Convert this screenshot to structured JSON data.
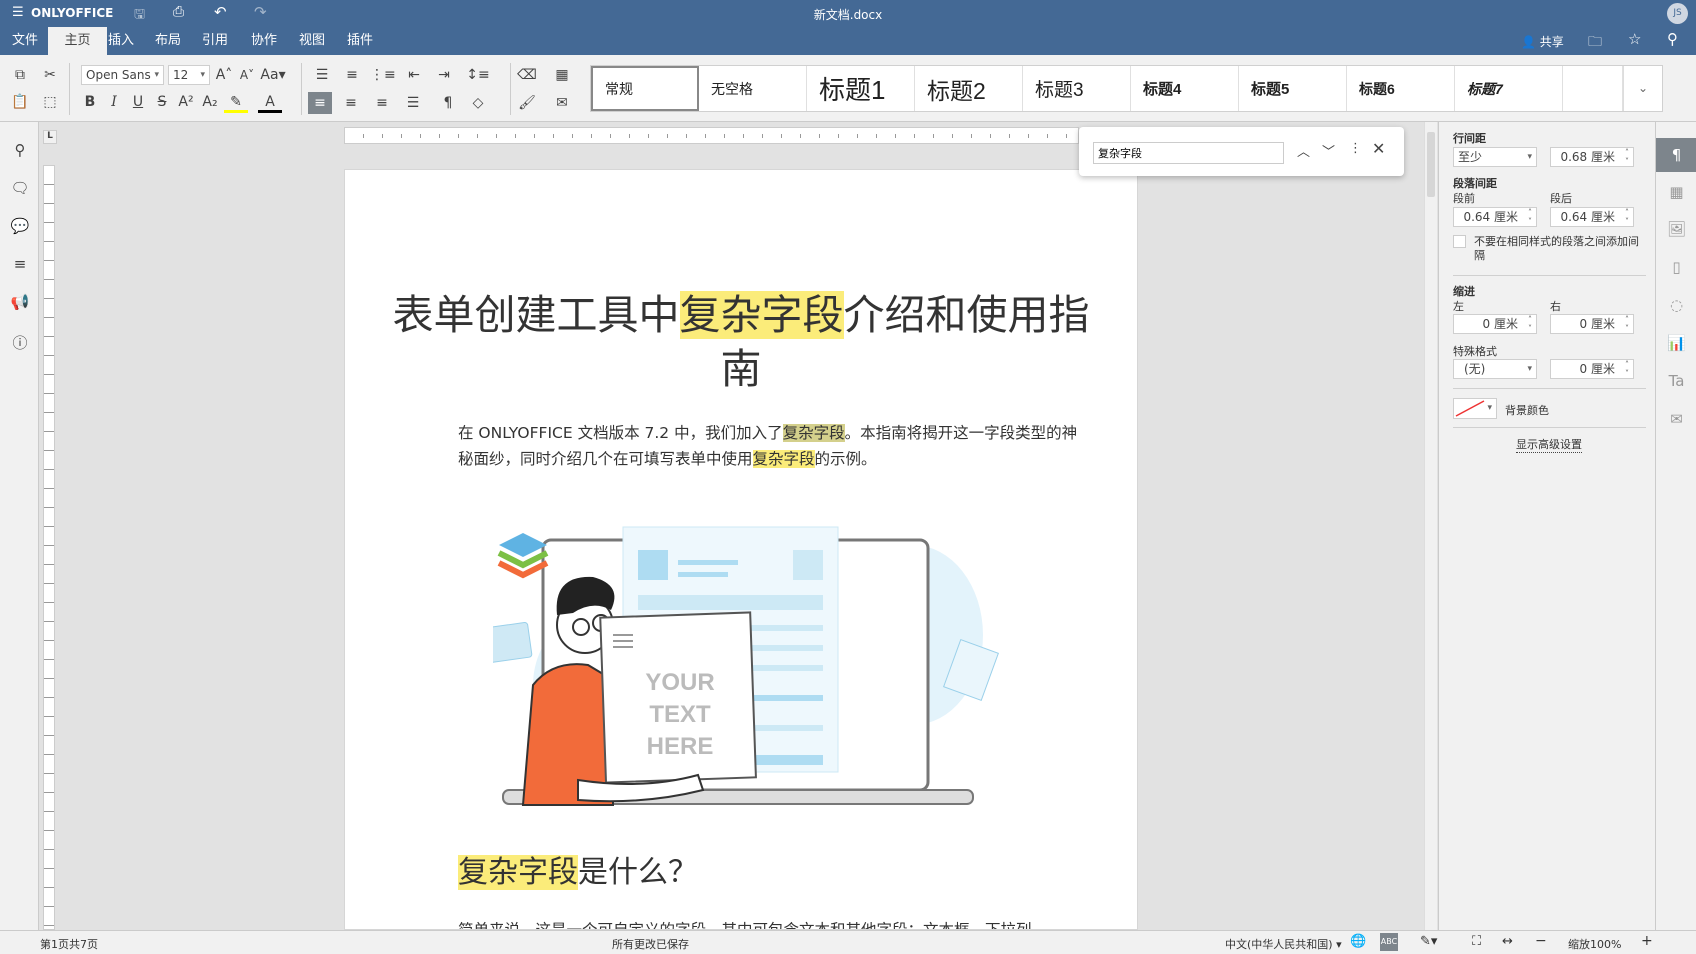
{
  "app": {
    "brand": "ONLYOFFICE",
    "doc_title": "新文档.docx",
    "avatar": "JS",
    "share_label": "共享"
  },
  "menu": {
    "tabs": [
      "文件",
      "主页",
      "插入",
      "布局",
      "引用",
      "协作",
      "视图",
      "插件"
    ],
    "active": "主页"
  },
  "toolbar": {
    "font_name": "Open Sans",
    "font_size": "12",
    "case_label": "Aa"
  },
  "styles": [
    "常规",
    "无空格",
    "标题1",
    "标题2",
    "标题3",
    "标题4",
    "标题5",
    "标题6",
    "标题7"
  ],
  "find": {
    "value": "复杂字段"
  },
  "document": {
    "title_pre": "表单创建工具中",
    "title_hl": "复杂字段",
    "title_post": "介绍和使用指南",
    "p1_a": "在 ONLYOFFICE 文档版本 7.2 中，我们加入了",
    "p1_hl1": "复杂字段",
    "p1_b": "。本指南将揭开这一字段类型的神秘面纱，同时介绍几个在可填写表单中使用",
    "p1_hl2": "复杂字段",
    "p1_c": "的示例。",
    "illus_text": [
      "YOUR",
      "TEXT",
      "HERE"
    ],
    "h2_hl": "复杂字段",
    "h2_post": "是什么？",
    "p2": "简单来说，这是一个可自定义的字段，其中可包含文本和其他字段：文本框、下拉列"
  },
  "panel": {
    "line_spacing": "行间距",
    "line_mode": "至少",
    "line_value": "0.68 厘米",
    "para_spacing": "段落间距",
    "before": "段前",
    "after": "段后",
    "before_value": "0.64 厘米",
    "after_value": "0.64 厘米",
    "no_space_label": "不要在相同样式的段落之间添加间隔",
    "indent": "缩进",
    "left": "左",
    "right": "右",
    "left_value": "0 厘米",
    "right_value": "0 厘米",
    "special": "特殊格式",
    "special_mode": "(无)",
    "special_value": "0 厘米",
    "bg_color": "背景颜色",
    "advanced": "显示高级设置"
  },
  "status": {
    "page": "第1页共7页",
    "saved": "所有更改已保存",
    "language": "中文(中华人民共和国)",
    "zoom": "缩放100%"
  }
}
